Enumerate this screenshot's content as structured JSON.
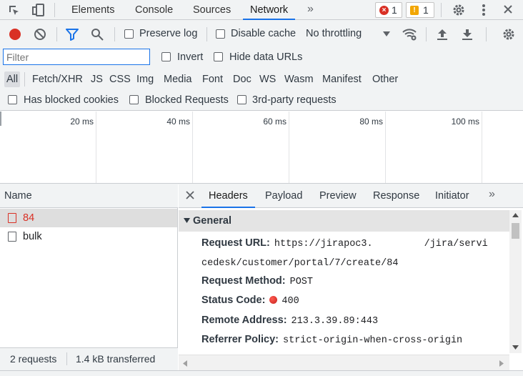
{
  "top_tabs": {
    "items": [
      {
        "label": "Elements"
      },
      {
        "label": "Console"
      },
      {
        "label": "Sources"
      },
      {
        "label": "Network"
      }
    ],
    "active": "Network",
    "more_icon": "double-chevron-right-icon",
    "errors_count": "1",
    "warnings_count": "1",
    "icons": [
      "inspect-element-icon",
      "device-toggle-icon",
      "gear-icon",
      "kebab-menu-icon",
      "close-icon"
    ]
  },
  "toolbar": {
    "preserve_log": "Preserve log",
    "disable_cache": "Disable cache",
    "throttling": "No throttling",
    "icons": [
      "record-icon",
      "clear-icon",
      "filter-icon",
      "search-icon",
      "wifi-settings-icon",
      "upload-icon",
      "download-icon",
      "gear-icon"
    ],
    "record_color": "#d93025",
    "filter_color": "#1a73e8"
  },
  "filter": {
    "placeholder": "Filter",
    "value": "",
    "invert": "Invert",
    "hide_data_urls": "Hide data URLs"
  },
  "type_filters": [
    "All",
    "Fetch/XHR",
    "JS",
    "CSS",
    "Img",
    "Media",
    "Font",
    "Doc",
    "WS",
    "Wasm",
    "Manifest",
    "Other"
  ],
  "cookie_filters": {
    "blocked_cookies": "Has blocked cookies",
    "blocked_requests": "Blocked Requests",
    "third_party": "3rd-party requests"
  },
  "overview": {
    "ticks": [
      "20 ms",
      "40 ms",
      "60 ms",
      "80 ms",
      "100 ms"
    ]
  },
  "requests": {
    "header": "Name",
    "items": [
      {
        "name": "84",
        "status": "error"
      },
      {
        "name": "bulk",
        "status": "ok"
      }
    ],
    "status_count": "2 requests",
    "status_transferred": "1.4 kB transferred",
    "error_color": "#d93025"
  },
  "detail": {
    "tabs": [
      "Headers",
      "Payload",
      "Preview",
      "Response",
      "Initiator"
    ],
    "active_tab": "Headers",
    "section": "General",
    "request_url_key": "Request URL:",
    "request_url_part1": "https://jirapoc3.",
    "request_url_part2": "/jira/servi",
    "request_url_line2": "cedesk/customer/portal/7/create/84",
    "request_method_key": "Request Method:",
    "request_method": "POST",
    "status_code_key": "Status Code:",
    "status_code": "400",
    "remote_address_key": "Remote Address:",
    "remote_address": "213.3.39.89:443",
    "referrer_policy_key": "Referrer Policy:",
    "referrer_policy": "strict-origin-when-cross-origin"
  }
}
